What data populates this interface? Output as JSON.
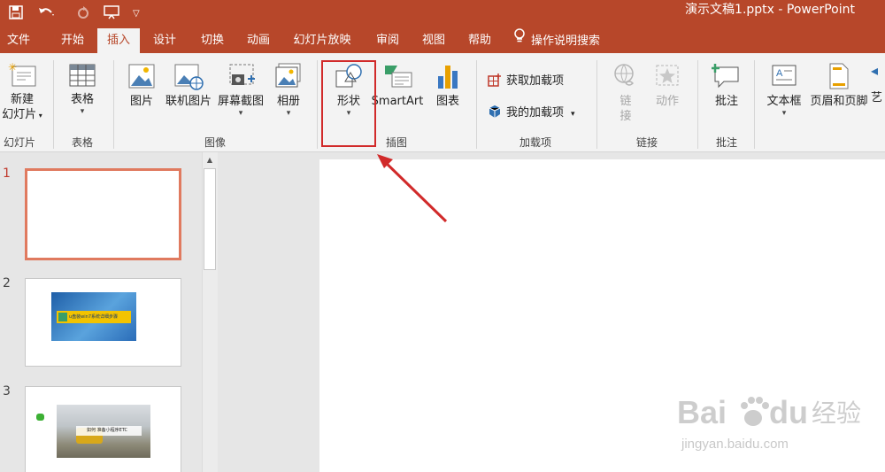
{
  "app": {
    "title": "演示文稿1.pptx - PowerPoint",
    "brand_color": "#b7472a",
    "highlight_color": "#d12a2a"
  },
  "quick_access": [
    "save-icon",
    "undo-icon",
    "redo-icon",
    "present-icon",
    "customize-icon"
  ],
  "tabs": [
    {
      "label": "文件"
    },
    {
      "label": "开始"
    },
    {
      "label": "插入",
      "active": true
    },
    {
      "label": "设计"
    },
    {
      "label": "切换"
    },
    {
      "label": "动画"
    },
    {
      "label": "幻灯片放映"
    },
    {
      "label": "审阅"
    },
    {
      "label": "视图"
    },
    {
      "label": "帮助"
    },
    {
      "label": "操作说明搜索",
      "icon": "lightbulb-icon"
    }
  ],
  "ribbon": {
    "new_slide": {
      "line1": "新建",
      "line2": "幻灯片"
    },
    "table": "表格",
    "picture": "图片",
    "online_picture": "联机图片",
    "screenshot": "屏幕截图",
    "album": "相册",
    "shapes": "形状",
    "smartart": "SmartArt",
    "chart": "图表",
    "get_addins": "获取加载项",
    "my_addins": "我的加载项",
    "link": {
      "line1": "链",
      "line2": "接"
    },
    "action": "动作",
    "comment": "批注",
    "textbox": "文本框",
    "header_footer": "页眉和页脚",
    "wordart": "艺",
    "groups": {
      "slides": "幻灯片",
      "tables": "表格",
      "images": "图像",
      "illustrations": "插图",
      "addins": "加载项",
      "links": "链接",
      "comments": "批注"
    }
  },
  "slides": [
    {
      "number": "1",
      "selected": true,
      "content": ""
    },
    {
      "number": "2",
      "selected": false,
      "content": "u盘装win7系统详细步骤"
    },
    {
      "number": "3",
      "selected": false,
      "content": "如何 准备小程序ETC"
    }
  ],
  "watermark": {
    "brand": "Bai",
    "brand2": "du",
    "brand_cn": "经验",
    "url": "jingyan.baidu.com"
  }
}
